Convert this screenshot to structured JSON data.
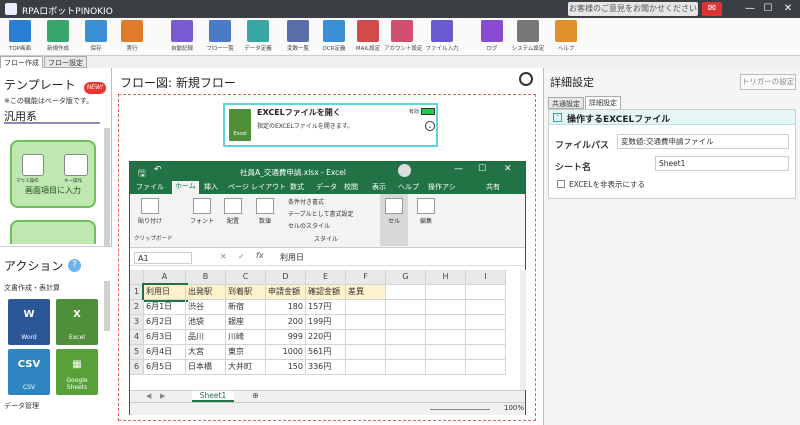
{
  "window": {
    "title": "RPAロボットPINOKIO",
    "feedback": "お客様のご意見をお聞かせください"
  },
  "toolbar": [
    {
      "label": "TOP画面",
      "color": "#2a7fd4"
    },
    {
      "label": "新規作成",
      "color": "#3aa56b"
    },
    {
      "label": "保存",
      "color": "#3a8fd4"
    },
    {
      "label": "実行",
      "color": "#e07b2a"
    },
    {
      "label": "自動記録",
      "color": "#7a5ad0"
    },
    {
      "label": "フロー一覧",
      "color": "#4b7ac9"
    },
    {
      "label": "データ定義",
      "color": "#3aa5a5"
    },
    {
      "label": "変数一覧",
      "color": "#5a6fa8"
    },
    {
      "label": "OCR定義",
      "color": "#3a8fd4"
    },
    {
      "label": "MAIL設定",
      "color": "#d04b4b"
    },
    {
      "label": "アカウント設定",
      "color": "#d0506e"
    },
    {
      "label": "ファイル入力",
      "color": "#6a5ad0"
    },
    {
      "label": "ログ",
      "color": "#8a4bd0"
    },
    {
      "label": "システム設定",
      "color": "#777777"
    },
    {
      "label": "ヘルプ",
      "color": "#e0902a"
    }
  ],
  "left": {
    "tabs": [
      "フロー作成",
      "フロー設定"
    ],
    "template_title": "テンプレート",
    "new_badge": "NEW!",
    "beta_note": "※この機能はベータ版です。",
    "category": "汎用系",
    "card_label": "画面項目に入力",
    "card_sub1": "マウス操作",
    "card_sub2": "キー操作",
    "action_title": "アクション",
    "help": "?",
    "group1": "文書作成・表計算",
    "actions": [
      {
        "big": "W",
        "sm": "Word",
        "color": "#2b5797"
      },
      {
        "big": "X",
        "sm": "Excel",
        "color": "#4f8f3a"
      },
      {
        "big": "CSV",
        "sm": "CSV",
        "color": "#2f85c0"
      },
      {
        "big": "▦",
        "sm": "Google Sheets",
        "color": "#5aa03a"
      }
    ],
    "group2": "データ管理"
  },
  "center": {
    "title": "フロー図:  新規フロー",
    "node": {
      "title": "EXCELファイルを開く",
      "desc": "指定のEXCELファイルを開きます。",
      "status": "有効",
      "icon": "Excel"
    },
    "excel": {
      "filename": "社員A_交通費申請.xlsx  -  Excel",
      "tabs": [
        "ファイル",
        "ホーム",
        "挿入",
        "ページ レイアウト",
        "数式",
        "データ",
        "校閲",
        "表示",
        "ヘルプ",
        "操作アシ",
        "共有"
      ],
      "ribbon": {
        "paste": "貼り付け",
        "clipboard": "クリップボード",
        "font": "フォント",
        "align": "配置",
        "number": "数値",
        "cond": "条件付き書式",
        "table": "テーブルとして書式設定",
        "cellstyle": "セルのスタイル",
        "style": "スタイル",
        "cells": "セル",
        "edit": "編集"
      },
      "namebox": "A1",
      "formula": "利用日",
      "columns": [
        "A",
        "B",
        "C",
        "D",
        "E",
        "F",
        "G",
        "H",
        "I"
      ],
      "rows": [
        {
          "n": "1",
          "cells": [
            "利用日",
            "出発駅",
            "到着駅",
            "申請金額",
            "確認金額",
            "差異"
          ]
        },
        {
          "n": "2",
          "cells": [
            "6月1日",
            "渋谷",
            "新宿",
            "180",
            "157円",
            ""
          ]
        },
        {
          "n": "3",
          "cells": [
            "6月2日",
            "池袋",
            "銀座",
            "200",
            "199円",
            ""
          ]
        },
        {
          "n": "4",
          "cells": [
            "6月3日",
            "品川",
            "川崎",
            "999",
            "220円",
            ""
          ]
        },
        {
          "n": "5",
          "cells": [
            "6月4日",
            "大宮",
            "東京",
            "1000",
            "561円",
            ""
          ]
        },
        {
          "n": "6",
          "cells": [
            "6月5日",
            "日本橋",
            "大井町",
            "150",
            "336円",
            ""
          ]
        }
      ],
      "sheet": "Sheet1",
      "zoom": "100%"
    }
  },
  "right": {
    "title": "詳細設定",
    "trigger": "トリガーの設定",
    "tabs": [
      "共通設定",
      "詳細設定"
    ],
    "section": "操作するEXCELファイル",
    "filepath_label": "ファイルパス",
    "filepath_value": "変数値:交通費申請ファイル",
    "sheet_label": "シート名",
    "sheet_value": "Sheet1",
    "hide_label": "EXCELを非表示にする"
  }
}
